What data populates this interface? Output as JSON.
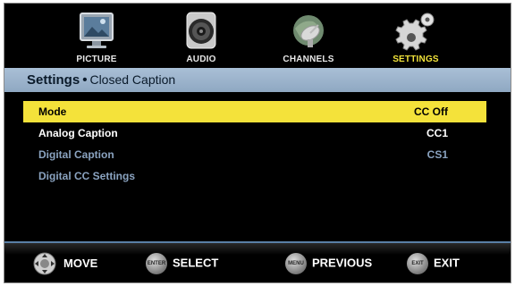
{
  "nav": {
    "tabs": [
      {
        "label": "PICTURE",
        "icon": "picture-icon"
      },
      {
        "label": "AUDIO",
        "icon": "speaker-icon"
      },
      {
        "label": "CHANNELS",
        "icon": "satellite-dish-icon"
      },
      {
        "label": "SETTINGS",
        "icon": "gears-icon"
      }
    ],
    "active_index": 3
  },
  "header": {
    "title": "Settings",
    "separator": "•",
    "subtitle": "Closed Caption"
  },
  "menu": {
    "items": [
      {
        "label": "Mode",
        "value": "CC Off",
        "state": "selected"
      },
      {
        "label": "Analog Caption",
        "value": "CC1",
        "state": "normal"
      },
      {
        "label": "Digital Caption",
        "value": "CS1",
        "state": "disabled"
      },
      {
        "label": "Digital CC Settings",
        "value": "",
        "state": "disabled"
      }
    ]
  },
  "footer": {
    "move": {
      "label": "MOVE",
      "icon": "dpad-icon"
    },
    "select": {
      "label": "SELECT",
      "button": "ENTER"
    },
    "previous": {
      "label": "PREVIOUS",
      "button": "MENU"
    },
    "exit": {
      "label": "EXIT",
      "button": "EXIT"
    }
  },
  "colors": {
    "highlight": "#f4e23a",
    "active_tab": "#f2e33a",
    "header_bar": "#9fb6cf",
    "disabled_text": "#8aa3c0"
  }
}
